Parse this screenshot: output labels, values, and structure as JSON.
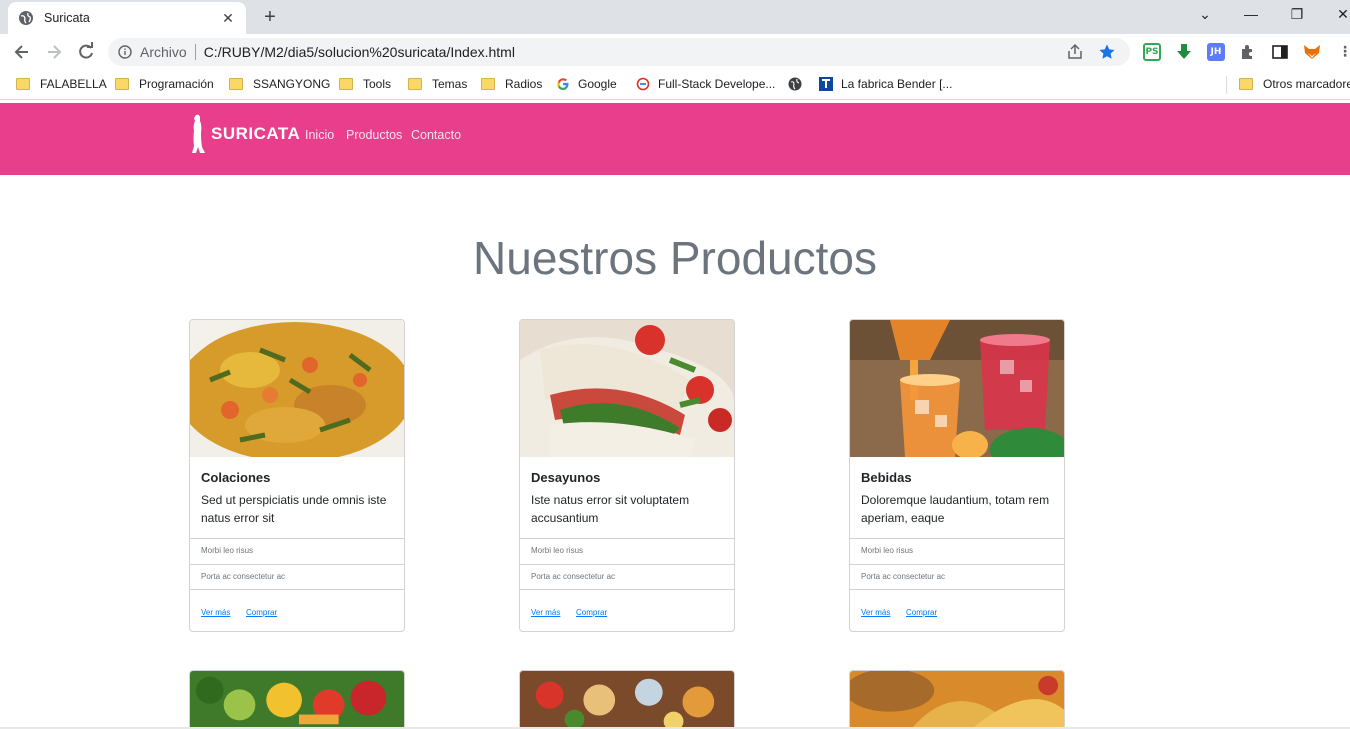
{
  "browser": {
    "tab_title": "Suricata",
    "scheme_label": "Archivo",
    "url": "C:/RUBY/M2/dia5/solucion%20suricata/Index.html",
    "bookmarks": [
      "FALABELLA",
      "Programación",
      "SSANGYONG",
      "Tools",
      "Temas",
      "Radios",
      "Google",
      "Full-Stack Develope...",
      "La fabrica Bender [...",
      "Otros marcadores"
    ],
    "extensions": [
      "PS",
      "JH"
    ]
  },
  "site": {
    "brand": "SURICATA",
    "nav": [
      "Inicio",
      "Productos",
      "Contacto"
    ],
    "heading": "Nuestros Productos",
    "cards": [
      {
        "title": "Colaciones",
        "text": "Sed ut perspiciatis unde omnis iste natus error sit",
        "items": [
          "Morbi leo risus",
          "Porta ac consectetur ac"
        ],
        "links": [
          "Ver más",
          "Comprar"
        ]
      },
      {
        "title": "Desayunos",
        "text": "Iste natus error sit voluptatem accusantium",
        "items": [
          "Morbi leo risus",
          "Porta ac consectetur ac"
        ],
        "links": [
          "Ver más",
          "Comprar"
        ]
      },
      {
        "title": "Bebidas",
        "text": "Doloremque laudantium, totam rem aperiam, eaque",
        "items": [
          "Morbi leo risus",
          "Porta ac consectetur ac"
        ],
        "links": [
          "Ver más",
          "Comprar"
        ]
      }
    ]
  },
  "colors": {
    "navbar": "#e83e8c",
    "heading": "#6c757d",
    "link": "#007bff"
  }
}
